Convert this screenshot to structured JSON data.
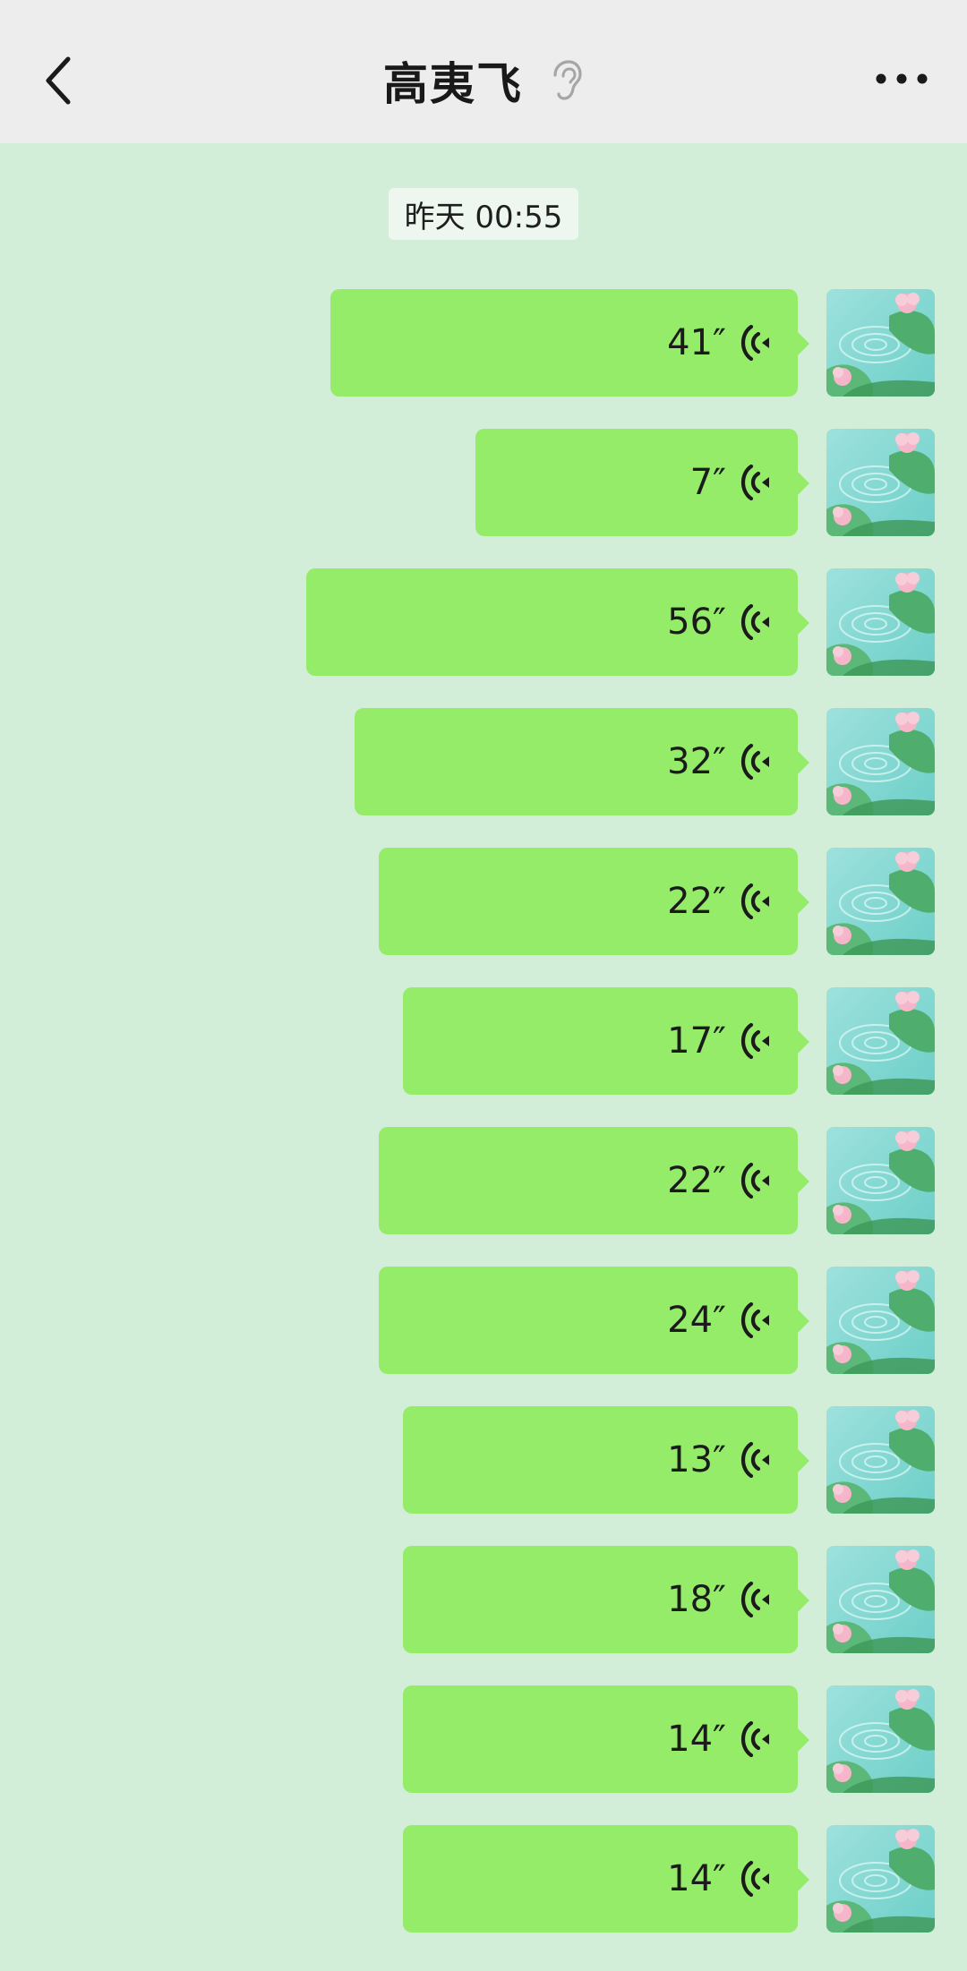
{
  "header": {
    "title": "高夷飞",
    "back_icon": "chevron-left-icon",
    "ear_icon": "ear-icon",
    "more_icon": "more-dots-icon"
  },
  "timestamp": "昨天 00:55",
  "colors": {
    "background": "#d2eed8",
    "header": "#ededed",
    "bubble": "#95ec69"
  },
  "messages": [
    {
      "duration": "41″",
      "seconds": 41
    },
    {
      "duration": "7″",
      "seconds": 7
    },
    {
      "duration": "56″",
      "seconds": 56
    },
    {
      "duration": "32″",
      "seconds": 32
    },
    {
      "duration": "22″",
      "seconds": 22
    },
    {
      "duration": "17″",
      "seconds": 17
    },
    {
      "duration": "22″",
      "seconds": 22
    },
    {
      "duration": "24″",
      "seconds": 24
    },
    {
      "duration": "13″",
      "seconds": 13
    },
    {
      "duration": "18″",
      "seconds": 18
    },
    {
      "duration": "14″",
      "seconds": 14
    },
    {
      "duration": "14″",
      "seconds": 14
    }
  ]
}
